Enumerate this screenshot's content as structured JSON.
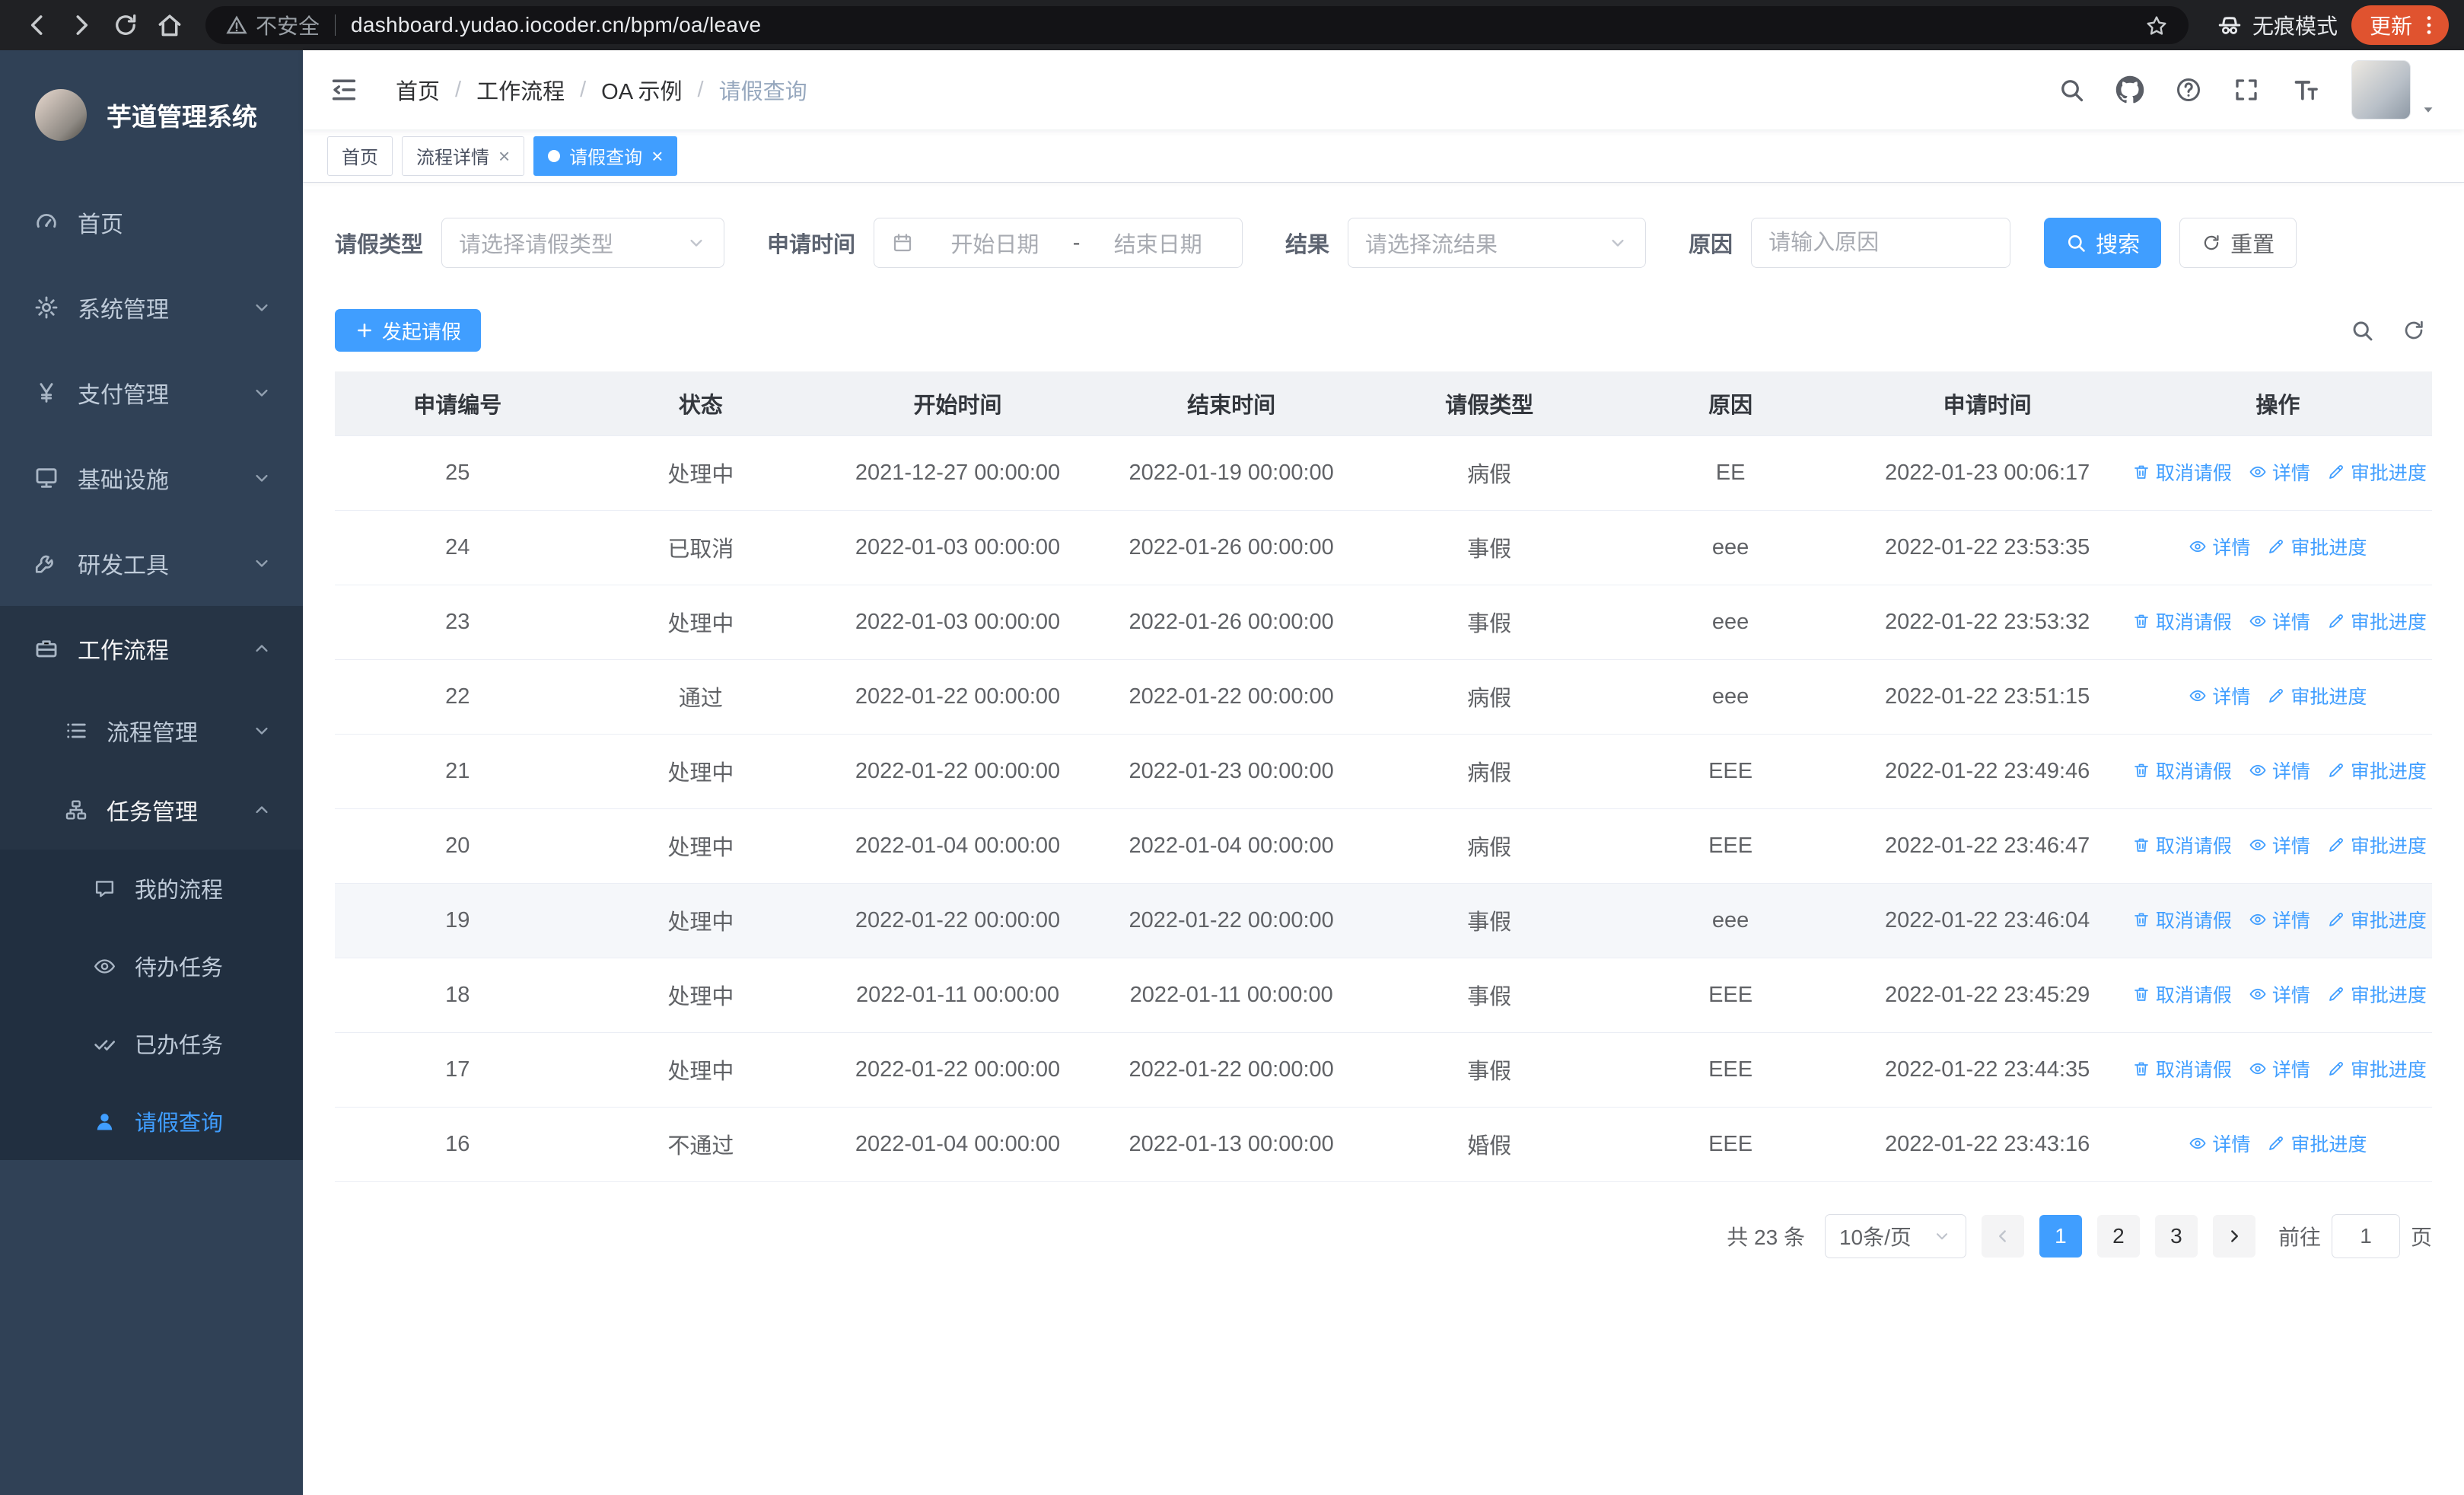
{
  "colors": {
    "primary": "#409eff",
    "sidebar_bg": "#304156",
    "update_badge": "#e0532f",
    "table_header_bg": "#f0f2f5"
  },
  "browser": {
    "security_label": "不安全",
    "url": "dashboard.yudao.iocoder.cn/bpm/oa/leave",
    "incognito_label": "无痕模式",
    "update_label": "更新"
  },
  "sidebar": {
    "logo_title": "芋道管理系统",
    "items": [
      {
        "label": "首页"
      },
      {
        "label": "系统管理"
      },
      {
        "label": "支付管理"
      },
      {
        "label": "基础设施"
      },
      {
        "label": "研发工具"
      },
      {
        "label": "工作流程"
      }
    ],
    "workflow_children": [
      {
        "label": "流程管理"
      },
      {
        "label": "任务管理"
      }
    ],
    "task_children": [
      {
        "label": "我的流程"
      },
      {
        "label": "待办任务"
      },
      {
        "label": "已办任务"
      },
      {
        "label": "请假查询"
      }
    ]
  },
  "header": {
    "breadcrumb_separator": "/",
    "breadcrumb": [
      {
        "label": "首页"
      },
      {
        "label": "工作流程"
      },
      {
        "label": "OA 示例"
      },
      {
        "label": "请假查询"
      }
    ]
  },
  "tabs": [
    {
      "label": "首页"
    },
    {
      "label": "流程详情"
    },
    {
      "label": "请假查询"
    }
  ],
  "filters": {
    "leave_type_label": "请假类型",
    "leave_type_placeholder": "请选择请假类型",
    "apply_time_label": "申请时间",
    "start_date_placeholder": "开始日期",
    "range_separator": "-",
    "end_date_placeholder": "结束日期",
    "result_label": "结果",
    "result_placeholder": "请选择流结果",
    "reason_label": "原因",
    "reason_placeholder": "请输入原因",
    "search_button": "搜索",
    "reset_button": "重置"
  },
  "toolbar": {
    "create_button": "发起请假"
  },
  "table": {
    "columns": [
      "申请编号",
      "状态",
      "开始时间",
      "结束时间",
      "请假类型",
      "原因",
      "申请时间",
      "操作"
    ],
    "actions": {
      "cancel": "取消请假",
      "detail": "详情",
      "progress": "审批进度"
    },
    "rows": [
      {
        "id": "25",
        "status": "处理中",
        "start": "2021-12-27 00:00:00",
        "end": "2022-01-19 00:00:00",
        "type": "病假",
        "reason": "EE",
        "applied": "2022-01-23 00:06:17",
        "cancelable": true,
        "hover": false
      },
      {
        "id": "24",
        "status": "已取消",
        "start": "2022-01-03 00:00:00",
        "end": "2022-01-26 00:00:00",
        "type": "事假",
        "reason": "eee",
        "applied": "2022-01-22 23:53:35",
        "cancelable": false,
        "hover": false
      },
      {
        "id": "23",
        "status": "处理中",
        "start": "2022-01-03 00:00:00",
        "end": "2022-01-26 00:00:00",
        "type": "事假",
        "reason": "eee",
        "applied": "2022-01-22 23:53:32",
        "cancelable": true,
        "hover": false
      },
      {
        "id": "22",
        "status": "通过",
        "start": "2022-01-22 00:00:00",
        "end": "2022-01-22 00:00:00",
        "type": "病假",
        "reason": "eee",
        "applied": "2022-01-22 23:51:15",
        "cancelable": false,
        "hover": false
      },
      {
        "id": "21",
        "status": "处理中",
        "start": "2022-01-22 00:00:00",
        "end": "2022-01-23 00:00:00",
        "type": "病假",
        "reason": "EEE",
        "applied": "2022-01-22 23:49:46",
        "cancelable": true,
        "hover": false
      },
      {
        "id": "20",
        "status": "处理中",
        "start": "2022-01-04 00:00:00",
        "end": "2022-01-04 00:00:00",
        "type": "病假",
        "reason": "EEE",
        "applied": "2022-01-22 23:46:47",
        "cancelable": true,
        "hover": false
      },
      {
        "id": "19",
        "status": "处理中",
        "start": "2022-01-22 00:00:00",
        "end": "2022-01-22 00:00:00",
        "type": "事假",
        "reason": "eee",
        "applied": "2022-01-22 23:46:04",
        "cancelable": true,
        "hover": true
      },
      {
        "id": "18",
        "status": "处理中",
        "start": "2022-01-11 00:00:00",
        "end": "2022-01-11 00:00:00",
        "type": "事假",
        "reason": "EEE",
        "applied": "2022-01-22 23:45:29",
        "cancelable": true,
        "hover": false
      },
      {
        "id": "17",
        "status": "处理中",
        "start": "2022-01-22 00:00:00",
        "end": "2022-01-22 00:00:00",
        "type": "事假",
        "reason": "EEE",
        "applied": "2022-01-22 23:44:35",
        "cancelable": true,
        "hover": false
      },
      {
        "id": "16",
        "status": "不通过",
        "start": "2022-01-04 00:00:00",
        "end": "2022-01-13 00:00:00",
        "type": "婚假",
        "reason": "EEE",
        "applied": "2022-01-22 23:43:16",
        "cancelable": false,
        "hover": false
      }
    ]
  },
  "pagination": {
    "total": "共 23 条",
    "page_size": "10条/页",
    "pages": [
      "1",
      "2",
      "3"
    ],
    "goto_label": "前往",
    "goto_value": "1",
    "page_unit": "页"
  }
}
